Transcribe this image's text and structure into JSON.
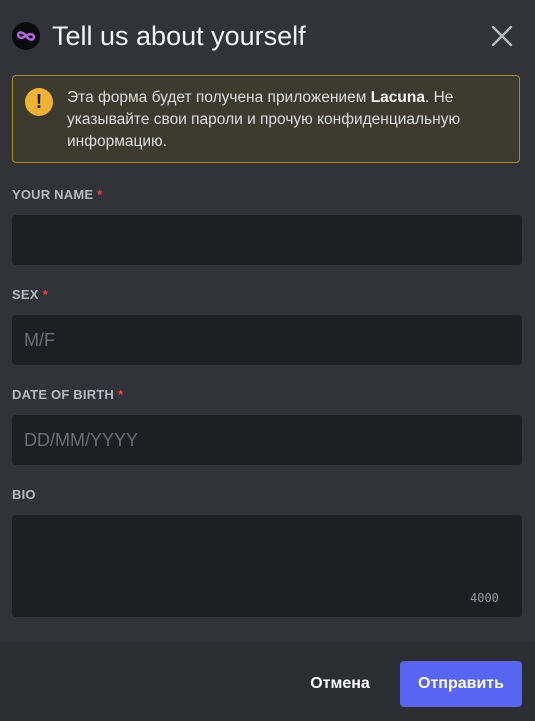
{
  "header": {
    "title": "Tell us about yourself",
    "app_icon": "infinity-icon",
    "close_icon": "close-icon"
  },
  "warning": {
    "icon": "exclamation-icon",
    "text_before": "Эта форма будет получена приложением ",
    "app_name": "Lacuna",
    "text_after": ". Не указывайте свои пароли и прочую конфиденциальную информацию."
  },
  "fields": {
    "name": {
      "label": "YOUR NAME",
      "required_mark": "*",
      "value": "",
      "placeholder": ""
    },
    "sex": {
      "label": "SEX",
      "required_mark": "*",
      "value": "",
      "placeholder": "M/F"
    },
    "dob": {
      "label": "DATE OF BIRTH",
      "required_mark": "*",
      "value": "",
      "placeholder": "DD/MM/YYYY"
    },
    "bio": {
      "label": "BIO",
      "value": "",
      "placeholder": "",
      "char_limit": "4000"
    }
  },
  "footer": {
    "cancel_label": "Отмена",
    "submit_label": "Отправить"
  },
  "colors": {
    "background": "#313338",
    "input_background": "#1e1f22",
    "footer_background": "#2b2d31",
    "warning_border": "#a68b2c",
    "warning_icon": "#f0b232",
    "required": "#f23f43",
    "primary_button": "#5865f2"
  }
}
